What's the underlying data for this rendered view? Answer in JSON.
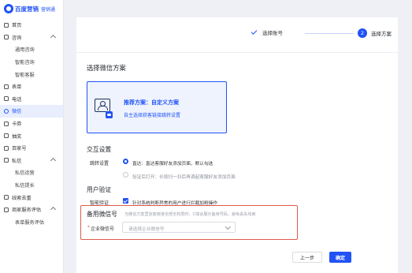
{
  "brand": {
    "name": "百度营销",
    "product": "营销通"
  },
  "sidebar": {
    "items": [
      {
        "label": "首页",
        "icon": "home-icon",
        "level": 0
      },
      {
        "label": "咨询",
        "icon": "chat-icon",
        "level": 0,
        "expandable": true
      },
      {
        "label": "通用咨询",
        "level": 1
      },
      {
        "label": "智能咨询",
        "level": 1
      },
      {
        "label": "智能客服",
        "level": 1
      },
      {
        "label": "表单",
        "icon": "form-icon",
        "level": 0
      },
      {
        "label": "电话",
        "icon": "phone-icon",
        "level": 0
      },
      {
        "label": "微信",
        "icon": "wechat-icon",
        "level": 0,
        "active": true
      },
      {
        "label": "卡券",
        "icon": "coupon-icon",
        "level": 0
      },
      {
        "label": "抽奖",
        "icon": "gift-icon",
        "level": 0
      },
      {
        "label": "百家号",
        "icon": "baijiahao-icon",
        "level": 0
      },
      {
        "label": "私信",
        "icon": "message-icon",
        "level": 0,
        "expandable": true
      },
      {
        "label": "私信运营",
        "level": 1
      },
      {
        "label": "私信提长",
        "level": 1
      },
      {
        "label": "线索去重",
        "icon": "clue-icon",
        "level": 0
      },
      {
        "label": "商家服务评估",
        "icon": "evaluate-icon",
        "level": 0,
        "expandable": true
      },
      {
        "label": "表单服务评估",
        "level": 1
      }
    ]
  },
  "steps": {
    "step1": "选择账号",
    "step2_num": "2",
    "step2": "选择方案"
  },
  "scheme": {
    "section_title": "选择微信方案",
    "card_title": "推荐方案：自定义方案",
    "card_link": "自主选择获客链接跳转设置"
  },
  "interaction": {
    "title": "交互设置",
    "jump_label": "跳转设置",
    "option1": "直达：直达客服好友添加页面，默认勾选",
    "option2": "验证后打开：长按扫一扫后再调起客服好友添加页面"
  },
  "verify": {
    "title": "用户验证",
    "label": "智能验证",
    "checkbox_text": "针对系统判断异常的用户进行拦截加粉操作"
  },
  "backup": {
    "title": "备用微信号",
    "hint": "当微信方案里获客链接全部无权限时，C端会展示备用号码，避免丢失线索",
    "required_mark": "*",
    "field_label": "企业微信号",
    "placeholder": "请选择企业微信号"
  },
  "footer": {
    "prev": "上一步",
    "confirm": "确定"
  },
  "colors": {
    "primary": "#2152f5",
    "highlight": "#e05a4d"
  }
}
